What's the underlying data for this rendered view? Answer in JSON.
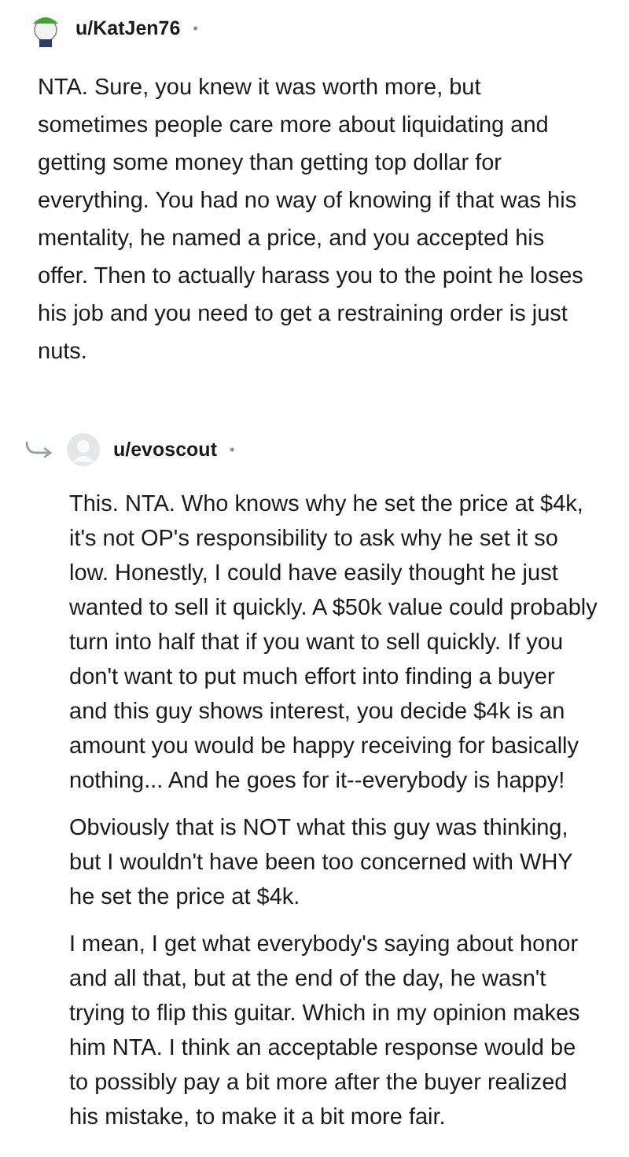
{
  "comment": {
    "username": "u/KatJen76",
    "separator": "•",
    "body": [
      "NTA. Sure, you knew it was worth more, but sometimes people care more about liquidating and getting some money than getting top dollar for everything. You had no way of knowing if that was his mentality, he named a price, and you accepted his offer. Then to actually harass you to the point he loses his job and you need to get a restraining order is just nuts."
    ]
  },
  "reply": {
    "username": "u/evoscout",
    "separator": "•",
    "body": [
      "This. NTA. Who knows why he set the price at $4k, it's not OP's responsibility to ask why he set it so low. Honestly, I could have easily thought he just wanted to sell it quickly. A $50k value could probably turn into half that if you want to sell quickly. If you don't want to put much effort into finding a buyer and this guy shows interest, you decide $4k is an amount you would be happy receiving for basically nothing... And he goes for it--everybody is happy!",
      "Obviously that is NOT what this guy was thinking, but I wouldn't have been too concerned with WHY he set the price at $4k.",
      "I mean, I get what everybody's saying about honor and all that, but at the end of the day, he wasn't trying to flip this guitar. Which in my opinion makes him NTA. I think an acceptable response would be to possibly pay a bit more after the buyer realized his mistake, to make it a bit more fair."
    ]
  }
}
